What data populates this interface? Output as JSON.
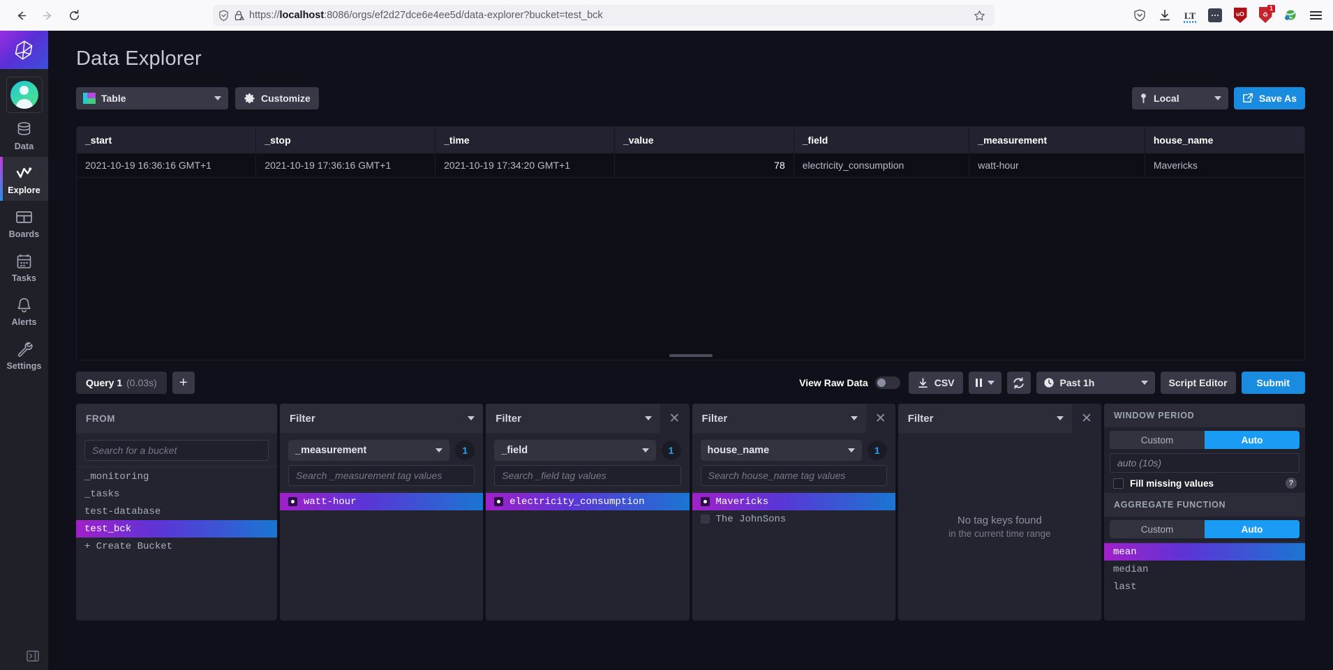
{
  "browser": {
    "back_icon": "arrow-left-icon",
    "forward_icon": "arrow-right-icon",
    "reload_icon": "reload-icon",
    "shield_icon": "tracking-shield-icon",
    "lock_icon": "lock-warning-icon",
    "url_prefix": "https://",
    "url_host": "localhost",
    "url_rest": ":8086/orgs/ef2d27dce6e4ee5d/data-explorer?bucket=test_bck",
    "url_full": "https://localhost:8086/orgs/ef2d27dce6e4ee5d/data-explorer?bucket=test_bck",
    "bookmark_icon": "star-icon",
    "extensions": [
      {
        "name": "pocket-icon",
        "label": ""
      },
      {
        "name": "downloads-icon",
        "label": ""
      },
      {
        "name": "languagetool-icon",
        "label": "LT"
      },
      {
        "name": "extension-dots-icon",
        "label": ""
      },
      {
        "name": "ublock-shield-icon",
        "label": "uO"
      },
      {
        "name": "privacy-badger-icon",
        "label": "♻",
        "badge": "1"
      },
      {
        "name": "download-manager-globe-icon",
        "label": ""
      }
    ],
    "menu_icon": "hamburger-menu-icon"
  },
  "nav": {
    "logo_icon": "influxdb-logo-icon",
    "avatar_icon": "user-avatar-icon",
    "items": [
      {
        "label": "Data",
        "icon": "database-icon",
        "active": false
      },
      {
        "label": "Explore",
        "icon": "graph-line-icon",
        "active": true
      },
      {
        "label": "Boards",
        "icon": "dashboard-grid-icon",
        "active": false
      },
      {
        "label": "Tasks",
        "icon": "calendar-clock-icon",
        "active": false
      },
      {
        "label": "Alerts",
        "icon": "bell-icon",
        "active": false
      },
      {
        "label": "Settings",
        "icon": "wrench-icon",
        "active": false
      }
    ],
    "collapse_icon": "collapse-panel-icon"
  },
  "header": {
    "title": "Data Explorer"
  },
  "toolbar": {
    "viz_type": "Table",
    "viz_icon": "table-icon",
    "customize_label": "Customize",
    "customize_icon": "gear-icon",
    "timezone": "Local",
    "timezone_icon": "globe-pin-icon",
    "save_as_label": "Save As",
    "save_as_icon": "external-link-icon"
  },
  "table": {
    "columns": [
      "_start",
      "_stop",
      "_time",
      "_value",
      "_field",
      "_measurement",
      "house_name"
    ],
    "rows": [
      {
        "_start": "2021-10-19 16:36:16 GMT+1",
        "_stop": "2021-10-19 17:36:16 GMT+1",
        "_time": "2021-10-19 17:34:20 GMT+1",
        "_value": "78",
        "_field": "electricity_consumption",
        "_measurement": "watt-hour",
        "house_name": "Mavericks"
      }
    ],
    "scrollbar_icon": "horizontal-scrollbar"
  },
  "query_bar": {
    "tab_name": "Query 1",
    "tab_time": "(0.03s)",
    "add_icon": "plus-icon",
    "raw_data_label": "View Raw Data",
    "raw_data_on": false,
    "csv_label": "CSV",
    "csv_icon": "download-icon",
    "pause_icon": "pause-icon",
    "refresh_icon": "refresh-icon",
    "time_range": "Past 1h",
    "time_range_icon": "clock-icon",
    "script_editor_label": "Script Editor",
    "submit_label": "Submit"
  },
  "builder": {
    "from": {
      "title": "FROM",
      "search_placeholder": "Search for a bucket",
      "buckets": [
        {
          "name": "_monitoring",
          "selected": false
        },
        {
          "name": "_tasks",
          "selected": false
        },
        {
          "name": "test-database",
          "selected": false
        },
        {
          "name": "test_bck",
          "selected": true
        }
      ],
      "create_label": "+ Create Bucket"
    },
    "filters": [
      {
        "title": "Filter",
        "tag_key": "_measurement",
        "count": "1",
        "search_placeholder": "Search _measurement tag values",
        "closable": false,
        "values": [
          {
            "name": "watt-hour",
            "selected": true
          }
        ]
      },
      {
        "title": "Filter",
        "tag_key": "_field",
        "count": "1",
        "search_placeholder": "Search _field tag values",
        "closable": true,
        "values": [
          {
            "name": "electricity_consumption",
            "selected": true
          }
        ]
      },
      {
        "title": "Filter",
        "tag_key": "house_name",
        "count": "1",
        "search_placeholder": "Search house_name tag values",
        "closable": true,
        "values": [
          {
            "name": "Mavericks",
            "selected": true
          },
          {
            "name": "The JohnSons",
            "selected": false
          }
        ]
      },
      {
        "title": "Filter",
        "closable": true,
        "empty_line1": "No tag keys found",
        "empty_line2": "in the current time range"
      }
    ],
    "aggregate": {
      "window_title": "WINDOW PERIOD",
      "window_custom": "Custom",
      "window_auto": "Auto",
      "window_mode": "Auto",
      "window_value": "auto (10s)",
      "fill_label": "Fill missing values",
      "fill_checked": false,
      "help_icon": "question-mark-icon",
      "agg_title": "AGGREGATE FUNCTION",
      "agg_custom": "Custom",
      "agg_auto": "Auto",
      "agg_mode": "Auto",
      "functions": [
        {
          "name": "mean",
          "selected": true
        },
        {
          "name": "median",
          "selected": false
        },
        {
          "name": "last",
          "selected": false
        }
      ]
    }
  },
  "colors": {
    "accent_blue": "#1a8cdf",
    "gradient_from": "#a020c9",
    "gradient_to": "#1a76d2",
    "panel_bg": "#232430",
    "page_bg": "#0f1019",
    "nav_bg": "#202028"
  }
}
